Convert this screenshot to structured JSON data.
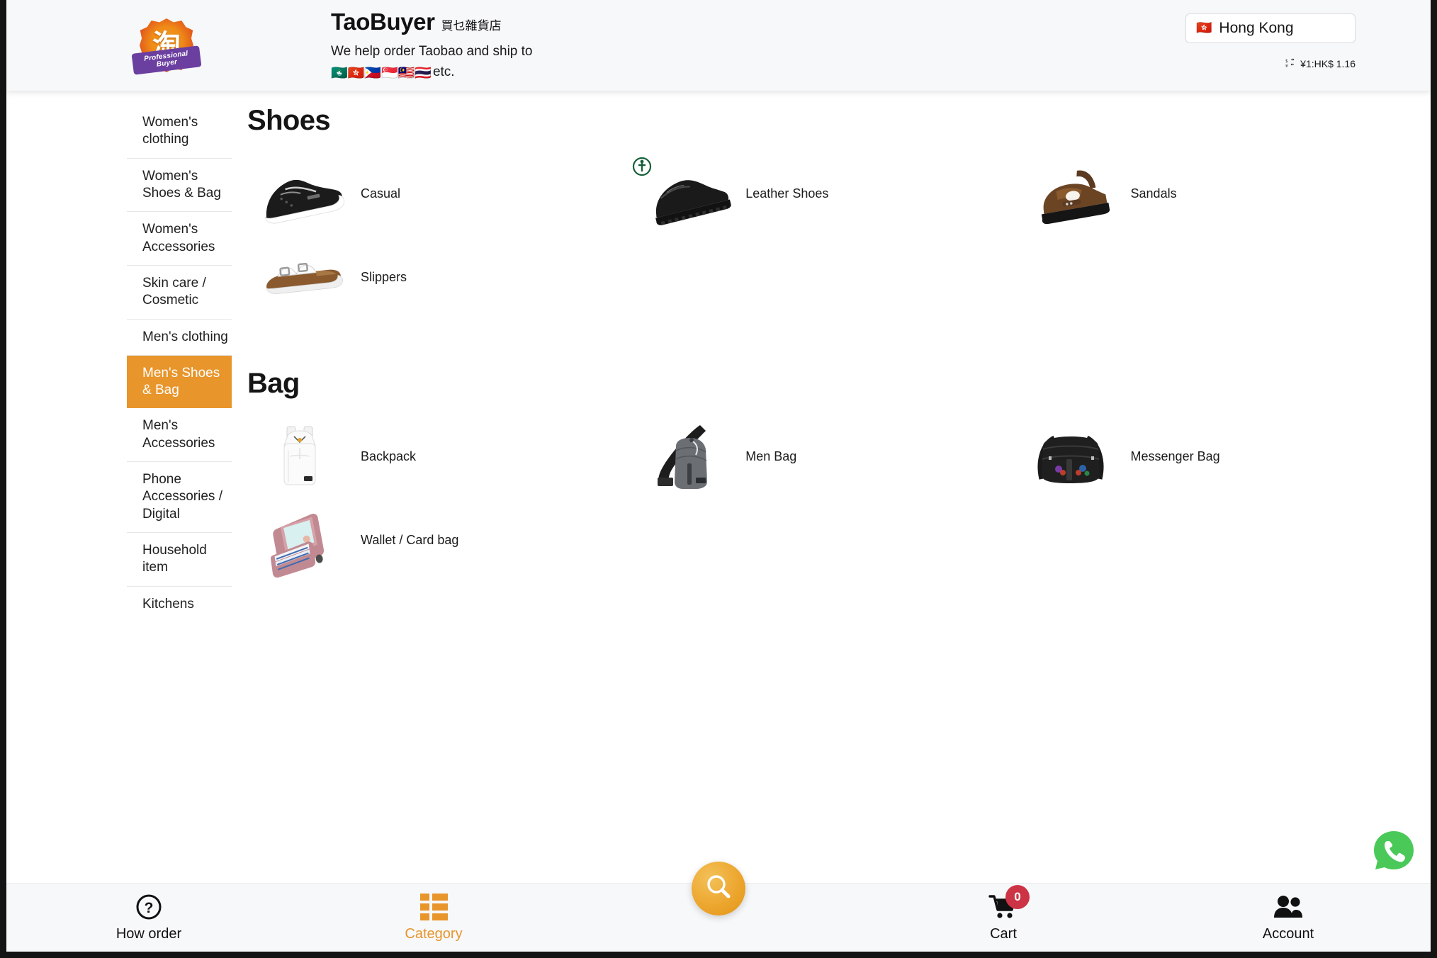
{
  "header": {
    "logo_icon": "taobuyer-logo-icon",
    "logo_cn_char": "淘",
    "logo_ribbon_line1": "Professional",
    "logo_ribbon_line2": "Buyer",
    "brand_name": "TaoBuyer",
    "brand_name_cn": "買乜雜貨店",
    "tagline": "We help order Taobao and ship to",
    "ship_flags": "🇲🇴🇭🇰🇵🇭🇸🇬🇲🇾🇹🇭",
    "ship_flags_suffix": "etc.",
    "country_flag": "🇭🇰",
    "country_name": "Hong Kong",
    "rate_icon": "currency-exchange-icon",
    "rate_text": "¥1:HK$ 1.16"
  },
  "sidebar": {
    "items": [
      {
        "label": "Women's clothing",
        "active": false
      },
      {
        "label": "Women's Shoes & Bag",
        "active": false
      },
      {
        "label": "Women's Accessories",
        "active": false
      },
      {
        "label": "Skin care / Cosmetic",
        "active": false
      },
      {
        "label": "Men's clothing",
        "active": false
      },
      {
        "label": "Men's Shoes & Bag",
        "active": true
      },
      {
        "label": "Men's Accessories",
        "active": false
      },
      {
        "label": "Phone Accessories / Digital",
        "active": false
      },
      {
        "label": "Household item",
        "active": false
      },
      {
        "label": "Kitchens",
        "active": false
      }
    ]
  },
  "main": {
    "sections": [
      {
        "title": "Shoes",
        "products": [
          {
            "label": "Casual",
            "icon": "sneaker-thumb"
          },
          {
            "label": "Leather Shoes",
            "icon": "leather-shoe-thumb"
          },
          {
            "label": "Sandals",
            "icon": "sandal-thumb"
          },
          {
            "label": "Slippers",
            "icon": "slipper-thumb"
          }
        ]
      },
      {
        "title": "Bag",
        "products": [
          {
            "label": "Backpack",
            "icon": "backpack-thumb"
          },
          {
            "label": "Men Bag",
            "icon": "sling-bag-thumb"
          },
          {
            "label": "Messenger Bag",
            "icon": "messenger-bag-thumb"
          },
          {
            "label": "Wallet / Card bag",
            "icon": "wallet-thumb"
          }
        ]
      }
    ]
  },
  "bottom_nav": {
    "items": [
      {
        "label": "How order",
        "icon": "question-mark-icon",
        "active": false
      },
      {
        "label": "Category",
        "icon": "grid-icon",
        "active": true
      },
      {
        "label": "Cart",
        "icon": "shopping-cart-icon",
        "active": false,
        "badge": "0"
      },
      {
        "label": "Account",
        "icon": "users-icon",
        "active": false
      }
    ],
    "search_icon": "magnifier-icon"
  },
  "floating": {
    "whatsapp_icon": "whatsapp-icon"
  },
  "colors": {
    "accent": "#e8952b",
    "badge": "#cc3344",
    "whatsapp": "#4ac959",
    "header_bg": "#f7f8fa"
  }
}
